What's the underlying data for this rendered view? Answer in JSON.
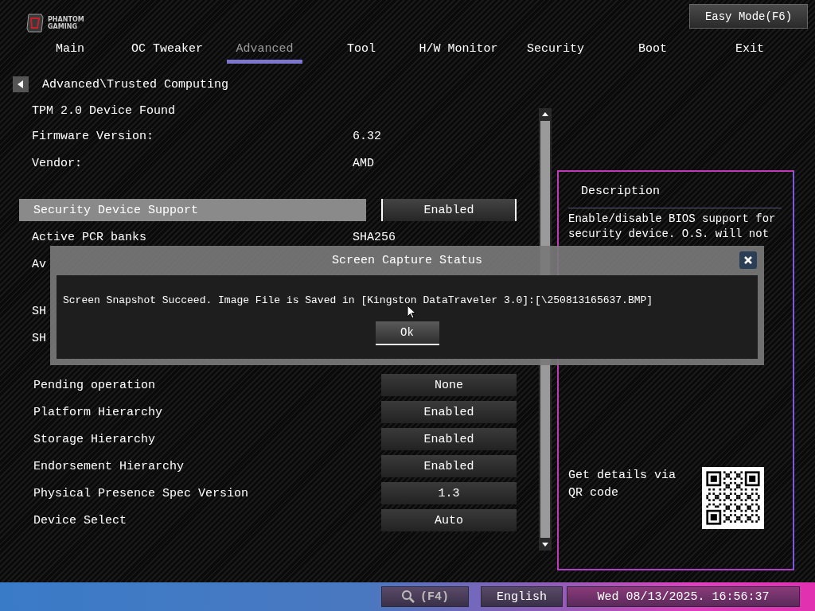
{
  "logo": {
    "line1": "PHANTOM",
    "line2": "GAMING"
  },
  "easy_mode_button": "Easy Mode(F6)",
  "tabs": [
    {
      "label": "Main",
      "selected": false
    },
    {
      "label": "OC Tweaker",
      "selected": false
    },
    {
      "label": "Advanced",
      "selected": true
    },
    {
      "label": "Tool",
      "selected": false
    },
    {
      "label": "H/W Monitor",
      "selected": false
    },
    {
      "label": "Security",
      "selected": false
    },
    {
      "label": "Boot",
      "selected": false
    },
    {
      "label": "Exit",
      "selected": false
    }
  ],
  "breadcrumb": "Advanced\\Trusted Computing",
  "settings": [
    {
      "kind": "heading",
      "label": "TPM 2.0 Device Found"
    },
    {
      "kind": "info",
      "label": "Firmware Version:",
      "value": "6.32"
    },
    {
      "kind": "info",
      "label": "Vendor:",
      "value": "AMD"
    },
    {
      "kind": "spacer"
    },
    {
      "kind": "option",
      "label": "Security Device Support",
      "value": "Enabled",
      "selected": true
    },
    {
      "kind": "info",
      "label": "Active PCR banks",
      "value": "SHA256"
    },
    {
      "kind": "info",
      "label": "Av"
    },
    {
      "kind": "spacer"
    },
    {
      "kind": "info",
      "label": "SH"
    },
    {
      "kind": "info",
      "label": "SH"
    },
    {
      "kind": "spacer"
    },
    {
      "kind": "option",
      "label": "Pending operation",
      "value": "None",
      "selected": false
    },
    {
      "kind": "option",
      "label": "Platform Hierarchy",
      "value": "Enabled",
      "selected": false
    },
    {
      "kind": "option",
      "label": "Storage Hierarchy",
      "value": "Enabled",
      "selected": false
    },
    {
      "kind": "option",
      "label": "Endorsement Hierarchy",
      "value": "Enabled",
      "selected": false
    },
    {
      "kind": "option",
      "label": "Physical Presence Spec Version",
      "value": "1.3",
      "selected": false
    },
    {
      "kind": "option",
      "label": "Device Select",
      "value": "Auto",
      "selected": false
    }
  ],
  "description": {
    "title": "Description",
    "lines": [
      "Enable/disable BIOS support for",
      "security device. O.S. will not"
    ],
    "qr_caption": "Get details via QR code"
  },
  "dialog": {
    "title": "Screen Capture Status",
    "message": "Screen Snapshot Succeed. Image File is Saved in  [Kingston DataTraveler 3.0]:[\\250813165637.BMP]",
    "ok_button": "Ok"
  },
  "status_bar": {
    "search_key": "(F4)",
    "language": "English",
    "datetime": "Wed 08/13/2025. 16:56:37"
  }
}
